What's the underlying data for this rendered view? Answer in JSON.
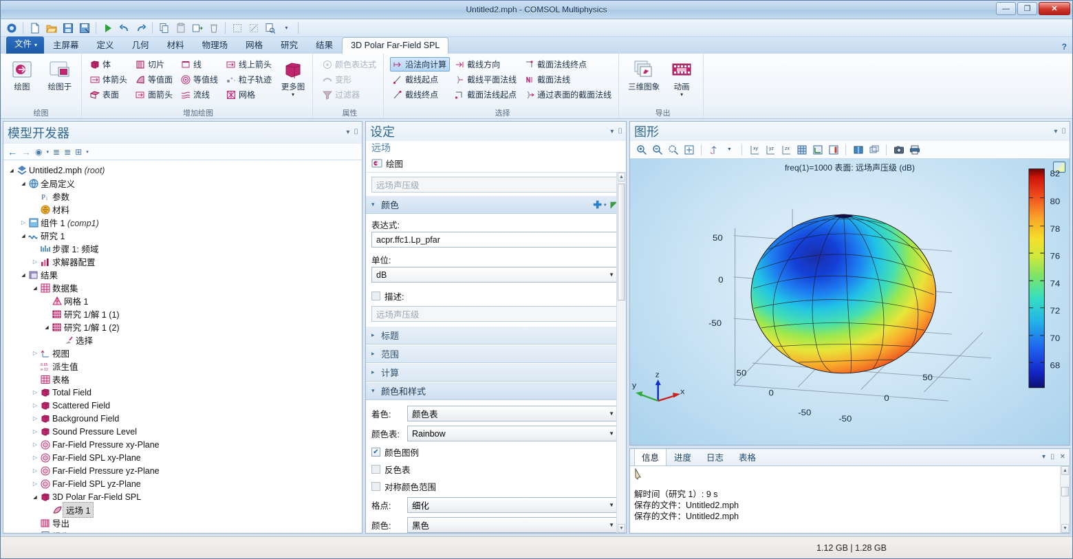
{
  "window": {
    "title": "Untitled2.mph - COMSOL Multiphysics",
    "minimize": "—",
    "maximize": "❐",
    "close": "✕"
  },
  "quick_access": [
    {
      "name": "app-menu-icon",
      "glyph": "◍"
    },
    {
      "name": "new-icon",
      "glyph": "🗋"
    },
    {
      "name": "open-icon",
      "glyph": "📂"
    },
    {
      "name": "save-icon",
      "glyph": "💾"
    },
    {
      "name": "save-as-icon",
      "glyph": "🖫"
    },
    {
      "name": "compute-icon",
      "glyph": "▶"
    },
    {
      "name": "undo-icon",
      "glyph": "↶"
    },
    {
      "name": "redo-icon",
      "glyph": "↷"
    },
    {
      "name": "copy-icon",
      "glyph": "⎘"
    },
    {
      "name": "paste-icon",
      "glyph": "📋"
    },
    {
      "name": "duplicate-icon",
      "glyph": "⎗"
    },
    {
      "name": "delete-icon",
      "glyph": "🗑"
    },
    {
      "name": "select-all-icon",
      "glyph": "⬚"
    },
    {
      "name": "clear-selection-icon",
      "glyph": "⌫"
    },
    {
      "name": "find-icon",
      "glyph": "🔍"
    },
    {
      "name": "dropdown-icon",
      "glyph": "▾"
    }
  ],
  "ribbon_tabs": {
    "file": "文件",
    "file_caret": "▾",
    "items": [
      "主屏幕",
      "定义",
      "几何",
      "材料",
      "物理场",
      "网格",
      "研究",
      "结果"
    ],
    "active": "3D Polar Far-Field SPL",
    "help": "?"
  },
  "ribbon": {
    "group_plot": {
      "title": "绘图",
      "buttons": [
        {
          "label": "绘图",
          "name": "plot-button"
        },
        {
          "label": "绘图于",
          "name": "plot-in-button"
        }
      ]
    },
    "group_add_plot": {
      "title": "增加绘图",
      "col1": [
        {
          "label": "体",
          "name": "volume"
        },
        {
          "label": "体箭头",
          "name": "arrow-volume"
        },
        {
          "label": "表面",
          "name": "surface"
        }
      ],
      "col2": [
        {
          "label": "切片",
          "name": "slice"
        },
        {
          "label": "等值面",
          "name": "isosurface"
        },
        {
          "label": "面箭头",
          "name": "arrow-surface"
        }
      ],
      "col3": [
        {
          "label": "线",
          "name": "line"
        },
        {
          "label": "等值线",
          "name": "contour"
        },
        {
          "label": "流线",
          "name": "streamline"
        }
      ],
      "col4": [
        {
          "label": "线上箭头",
          "name": "arrow-line"
        },
        {
          "label": "粒子轨迹",
          "name": "particle-trajectories"
        },
        {
          "label": "网格",
          "name": "mesh"
        }
      ],
      "more": {
        "label": "更多图",
        "caret": "▾",
        "name": "more-plots"
      }
    },
    "group_attributes": {
      "title": "属性",
      "items": [
        {
          "label": "颜色表达式",
          "name": "color-expression",
          "disabled": true
        },
        {
          "label": "变形",
          "name": "deformation",
          "disabled": true
        },
        {
          "label": "过滤器",
          "name": "filter",
          "disabled": true
        }
      ]
    },
    "group_selection": {
      "title": "选择",
      "col1": [
        {
          "label": "沿法向计算",
          "name": "evaluate-along-normal",
          "selected": true
        },
        {
          "label": "截线起点",
          "name": "cut-line-start"
        },
        {
          "label": "截线终点",
          "name": "cut-line-end"
        }
      ],
      "col2": [
        {
          "label": "截线方向",
          "name": "cut-line-direction"
        },
        {
          "label": "截线平面法线",
          "name": "cut-line-plane-normal"
        },
        {
          "label": "截面法线起点",
          "name": "cut-plane-normal-start"
        }
      ],
      "col3": [
        {
          "label": "截面法线终点",
          "name": "cut-plane-normal-end"
        },
        {
          "label": "截面法线",
          "name": "cut-plane-normal"
        },
        {
          "label": "通过表面的截面法线",
          "name": "cut-plane-normal-through-surface"
        }
      ]
    },
    "group_export": {
      "title": "导出",
      "buttons": [
        {
          "label": "三维图象",
          "name": "3d-image"
        },
        {
          "label": "动画",
          "caret": "▾",
          "name": "animation"
        }
      ]
    }
  },
  "model_builder": {
    "title": "模型开发器",
    "toolbar": [
      {
        "name": "back-icon",
        "glyph": "←"
      },
      {
        "name": "forward-icon",
        "glyph": "→"
      },
      {
        "name": "show-icon",
        "glyph": "👁"
      },
      {
        "name": "show-dropdown-icon",
        "glyph": "▾"
      },
      {
        "name": "collapse-icon",
        "glyph": "⇡"
      },
      {
        "name": "expand-icon",
        "glyph": "⇣"
      },
      {
        "name": "node-options-icon",
        "glyph": "⊞"
      },
      {
        "name": "node-options-dropdown-icon",
        "glyph": "▾"
      }
    ],
    "collapse_caret": "▾",
    "pin": "📌",
    "tree": [
      {
        "indent": 0,
        "arrow": "▾",
        "icon": "root",
        "label": "Untitled2.mph",
        "italic": "(root)"
      },
      {
        "indent": 1,
        "arrow": "▾",
        "icon": "globe",
        "label": "全局定义",
        "italic": ""
      },
      {
        "indent": 2,
        "arrow": "",
        "icon": "param",
        "label": "参数",
        "italic": ""
      },
      {
        "indent": 2,
        "arrow": "",
        "icon": "material",
        "label": "材料",
        "italic": ""
      },
      {
        "indent": 1,
        "arrow": "▸",
        "icon": "component",
        "label": "组件 1",
        "italic": "(comp1)"
      },
      {
        "indent": 1,
        "arrow": "▾",
        "icon": "study",
        "label": "研究 1",
        "italic": ""
      },
      {
        "indent": 2,
        "arrow": "",
        "icon": "step",
        "label": "步骤 1: 频域",
        "italic": ""
      },
      {
        "indent": 2,
        "arrow": "▸",
        "icon": "solver",
        "label": "求解器配置",
        "italic": ""
      },
      {
        "indent": 1,
        "arrow": "▾",
        "icon": "results",
        "label": "结果",
        "italic": ""
      },
      {
        "indent": 2,
        "arrow": "▾",
        "icon": "dataset",
        "label": "数据集",
        "italic": ""
      },
      {
        "indent": 3,
        "arrow": "",
        "icon": "mesh",
        "label": "网格 1",
        "italic": ""
      },
      {
        "indent": 3,
        "arrow": "",
        "icon": "solution",
        "label": "研究 1/解 1 (1)",
        "italic": ""
      },
      {
        "indent": 3,
        "arrow": "▾",
        "icon": "solution",
        "label": "研究 1/解 1 (2)",
        "italic": ""
      },
      {
        "indent": 4,
        "arrow": "",
        "icon": "selection",
        "label": "选择",
        "italic": ""
      },
      {
        "indent": 2,
        "arrow": "▸",
        "icon": "views",
        "label": "视图",
        "italic": ""
      },
      {
        "indent": 2,
        "arrow": "",
        "icon": "derived",
        "label": "派生值",
        "italic": ""
      },
      {
        "indent": 2,
        "arrow": "",
        "icon": "table",
        "label": "表格",
        "italic": ""
      },
      {
        "indent": 2,
        "arrow": "▸",
        "icon": "plotgroup",
        "label": "Total Field",
        "italic": ""
      },
      {
        "indent": 2,
        "arrow": "▸",
        "icon": "plotgroup",
        "label": "Scattered Field",
        "italic": ""
      },
      {
        "indent": 2,
        "arrow": "▸",
        "icon": "plotgroup",
        "label": "Background Field",
        "italic": ""
      },
      {
        "indent": 2,
        "arrow": "▸",
        "icon": "plotgroup",
        "label": "Sound Pressure Level",
        "italic": ""
      },
      {
        "indent": 2,
        "arrow": "▸",
        "icon": "polar",
        "label": "Far-Field Pressure xy-Plane",
        "italic": ""
      },
      {
        "indent": 2,
        "arrow": "▸",
        "icon": "polar",
        "label": "Far-Field SPL xy-Plane",
        "italic": ""
      },
      {
        "indent": 2,
        "arrow": "▸",
        "icon": "polar",
        "label": "Far-Field Pressure yz-Plane",
        "italic": ""
      },
      {
        "indent": 2,
        "arrow": "▸",
        "icon": "polar",
        "label": "Far-Field SPL yz-Plane",
        "italic": ""
      },
      {
        "indent": 2,
        "arrow": "▾",
        "icon": "plotgroup",
        "label": "3D Polar Far-Field SPL",
        "italic": ""
      },
      {
        "indent": 3,
        "arrow": "",
        "icon": "farfield",
        "label": "远场 1",
        "italic": "",
        "selected": true
      },
      {
        "indent": 2,
        "arrow": "",
        "icon": "export",
        "label": "导出",
        "italic": ""
      },
      {
        "indent": 2,
        "arrow": "",
        "icon": "report",
        "label": "报告",
        "italic": ""
      }
    ]
  },
  "settings": {
    "title": "设定",
    "subtitle": "远场",
    "plot_row_label": "绘图",
    "label_field_placeholder": "远场声压级",
    "collapse_caret": "▾",
    "pin": "📌",
    "sections": {
      "color": {
        "label": "颜色",
        "expanded_caret": "▾",
        "add_icon": "✚",
        "add_caret": "▾",
        "plot_icon": "◤",
        "plot_caret": "▾",
        "expression_label": "表达式:",
        "expression_value": "acpr.ffc1.Lp_pfar",
        "unit_label": "单位:",
        "unit_value": "dB",
        "description_label": "描述:",
        "description_placeholder": "远场声压级",
        "description_checked": false
      },
      "title": {
        "label": "标题",
        "caret": "▸"
      },
      "range": {
        "label": "范围",
        "caret": "▸"
      },
      "calculate": {
        "label": "计算",
        "caret": "▸"
      },
      "coloring_and_style": {
        "label": "颜色和样式",
        "caret": "▾",
        "coloring_label": "着色:",
        "coloring_value": "颜色表",
        "colortable_label": "颜色表:",
        "colortable_value": "Rainbow",
        "color_legend_label": "颜色图例",
        "color_legend_checked": true,
        "reverse_label": "反色表",
        "reverse_checked": false,
        "symmetric_label": "对称颜色范围",
        "symmetric_checked": false,
        "gridpoints_label": "格点:",
        "gridpoints_value": "细化",
        "color_label": "颜色:",
        "color_value": "黑色"
      }
    }
  },
  "graphics": {
    "title": "图形",
    "collapse_caret": "▾",
    "pin": "📌",
    "toolbar": [
      {
        "name": "zoom-in-icon",
        "glyph": "⊕"
      },
      {
        "name": "zoom-out-icon",
        "glyph": "⊖"
      },
      {
        "name": "zoom-box-icon",
        "glyph": "⊙"
      },
      {
        "name": "zoom-extents-icon",
        "glyph": "⤢"
      },
      {
        "name": "go-to-default-view-icon",
        "glyph": "⇲"
      },
      {
        "name": "view-dropdown-icon",
        "glyph": "▾"
      },
      {
        "name": "xy-view-icon",
        "glyph": "xy"
      },
      {
        "name": "yz-view-icon",
        "glyph": "yz"
      },
      {
        "name": "zx-view-icon",
        "glyph": "zx"
      },
      {
        "name": "grid-icon",
        "glyph": "▦"
      },
      {
        "name": "axis-icon",
        "glyph": "☑"
      },
      {
        "name": "legend-icon",
        "glyph": "▯"
      },
      {
        "name": "transparency-icon",
        "glyph": "◧"
      },
      {
        "name": "select-box-icon",
        "glyph": "❐"
      },
      {
        "name": "snapshot-icon",
        "glyph": "📷"
      },
      {
        "name": "print-icon",
        "glyph": "🖨"
      }
    ],
    "caption": "freq(1)=1000   表面: 远场声压级 (dB)"
  },
  "chart_data": {
    "type": "surface3d",
    "title": "freq(1)=1000   表面: 远场声压级 (dB)",
    "quantity": "Far-field sound pressure level",
    "expression": "acpr.ffc1.Lp_pfar",
    "unit": "dB",
    "frequency_hz": 1000,
    "colormap": "Rainbow",
    "colorbar": {
      "ticks": [
        68,
        70,
        72,
        74,
        76,
        78,
        80,
        82
      ],
      "min": 67.0,
      "max": 83.2,
      "orientation": "vertical",
      "position": "right"
    },
    "axes": {
      "x_ticks": [
        -50,
        0,
        50
      ],
      "y_ticks": [
        -50,
        0,
        50
      ],
      "z_ticks": [
        -50,
        0,
        50
      ],
      "x_label": "x",
      "y_label": "y",
      "z_label": "z"
    },
    "triad_labels": [
      "x",
      "y",
      "z"
    ],
    "description": "3D polar far-field sound pressure level radiation pattern rendered as a deformed sphere; dark blue (68 dB) on the upper-left/rear lobe grading through cyan and green to yellow, orange and red (82+ dB) on the lower-right/front lobe.",
    "grid": true
  },
  "messages": {
    "tabs": [
      "信息",
      "进度",
      "日志",
      "表格"
    ],
    "active_tab": "信息",
    "lines": [
      "解时间（研究 1）: 9 s",
      "保存的文件：Untitled2.mph",
      "保存的文件：Untitled2.mph"
    ],
    "actions": [
      {
        "name": "messages-collapse-icon",
        "glyph": "▾"
      },
      {
        "name": "messages-pin-icon",
        "glyph": "📌"
      },
      {
        "name": "messages-close-icon",
        "glyph": "✕"
      }
    ]
  },
  "statusbar": {
    "memory": "1.12 GB | 1.28 GB"
  }
}
